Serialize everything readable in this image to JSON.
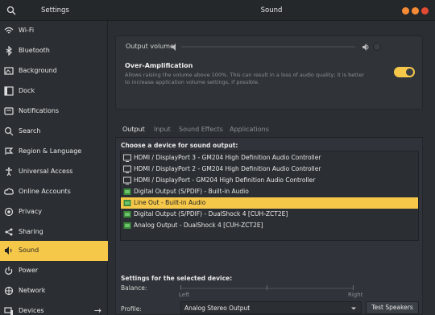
{
  "window": {
    "app_title": "Settings",
    "title": "Sound",
    "controls": {
      "min_color": "#f58c35",
      "max_color": "#f58c35",
      "close_color": "#e14b32"
    }
  },
  "sidebar": {
    "items": [
      {
        "label": "Wi-Fi",
        "icon": "wifi-icon"
      },
      {
        "label": "Bluetooth",
        "icon": "bluetooth-icon"
      },
      {
        "label": "Background",
        "icon": "background-icon"
      },
      {
        "label": "Dock",
        "icon": "dock-icon"
      },
      {
        "label": "Notifications",
        "icon": "notifications-icon"
      },
      {
        "label": "Search",
        "icon": "search-icon"
      },
      {
        "label": "Region & Language",
        "icon": "region-icon"
      },
      {
        "label": "Universal Access",
        "icon": "accessibility-icon"
      },
      {
        "label": "Online Accounts",
        "icon": "online-accounts-icon"
      },
      {
        "label": "Privacy",
        "icon": "privacy-icon"
      },
      {
        "label": "Sharing",
        "icon": "sharing-icon"
      },
      {
        "label": "Sound",
        "icon": "sound-icon",
        "active": true
      },
      {
        "label": "Power",
        "icon": "power-icon"
      },
      {
        "label": "Network",
        "icon": "network-icon"
      },
      {
        "label": "Devices",
        "icon": "devices-icon"
      }
    ],
    "devices_arrow": "→"
  },
  "volume": {
    "label": "Output volume:",
    "level": 0.0
  },
  "over_amplification": {
    "title": "Over-Amplification",
    "description": "Allows raising the volume above 100%. This can result in a loss of audio quality; it is better to increase application volume settings, if possible.",
    "enabled": true
  },
  "tabs": [
    "Output",
    "Input",
    "Sound Effects",
    "Applications"
  ],
  "active_tab": "Output",
  "output": {
    "heading": "Choose a device for sound output:",
    "devices": [
      {
        "label": "HDMI / DisplayPort 3 - GM204 High Definition Audio Controller",
        "icon": "monitor-icon"
      },
      {
        "label": "HDMI / DisplayPort 2 - GM204 High Definition Audio Controller",
        "icon": "monitor-icon"
      },
      {
        "label": "HDMI / DisplayPort - GM204 High Definition Audio Controller",
        "icon": "monitor-icon"
      },
      {
        "label": "Digital Output (S/PDIF) - Built-in Audio",
        "icon": "audio-card-icon"
      },
      {
        "label": "Line Out - Built-in Audio",
        "icon": "audio-card-icon",
        "selected": true
      },
      {
        "label": "Digital Output (S/PDIF) - DualShock 4 [CUH-ZCT2E]",
        "icon": "audio-card-icon"
      },
      {
        "label": "Analog Output - DualShock 4 [CUH-ZCT2E]",
        "icon": "audio-card-icon"
      }
    ],
    "settings_heading": "Settings for the selected device:",
    "balance_label": "Balance:",
    "balance_left": "Left",
    "balance_right": "Right",
    "profile_label": "Profile:",
    "profile_value": "Analog Stereo Output",
    "test_button": "Test Speakers"
  },
  "colors": {
    "accent": "#f6c84a",
    "sidebar_bg": "#2b2f33"
  }
}
